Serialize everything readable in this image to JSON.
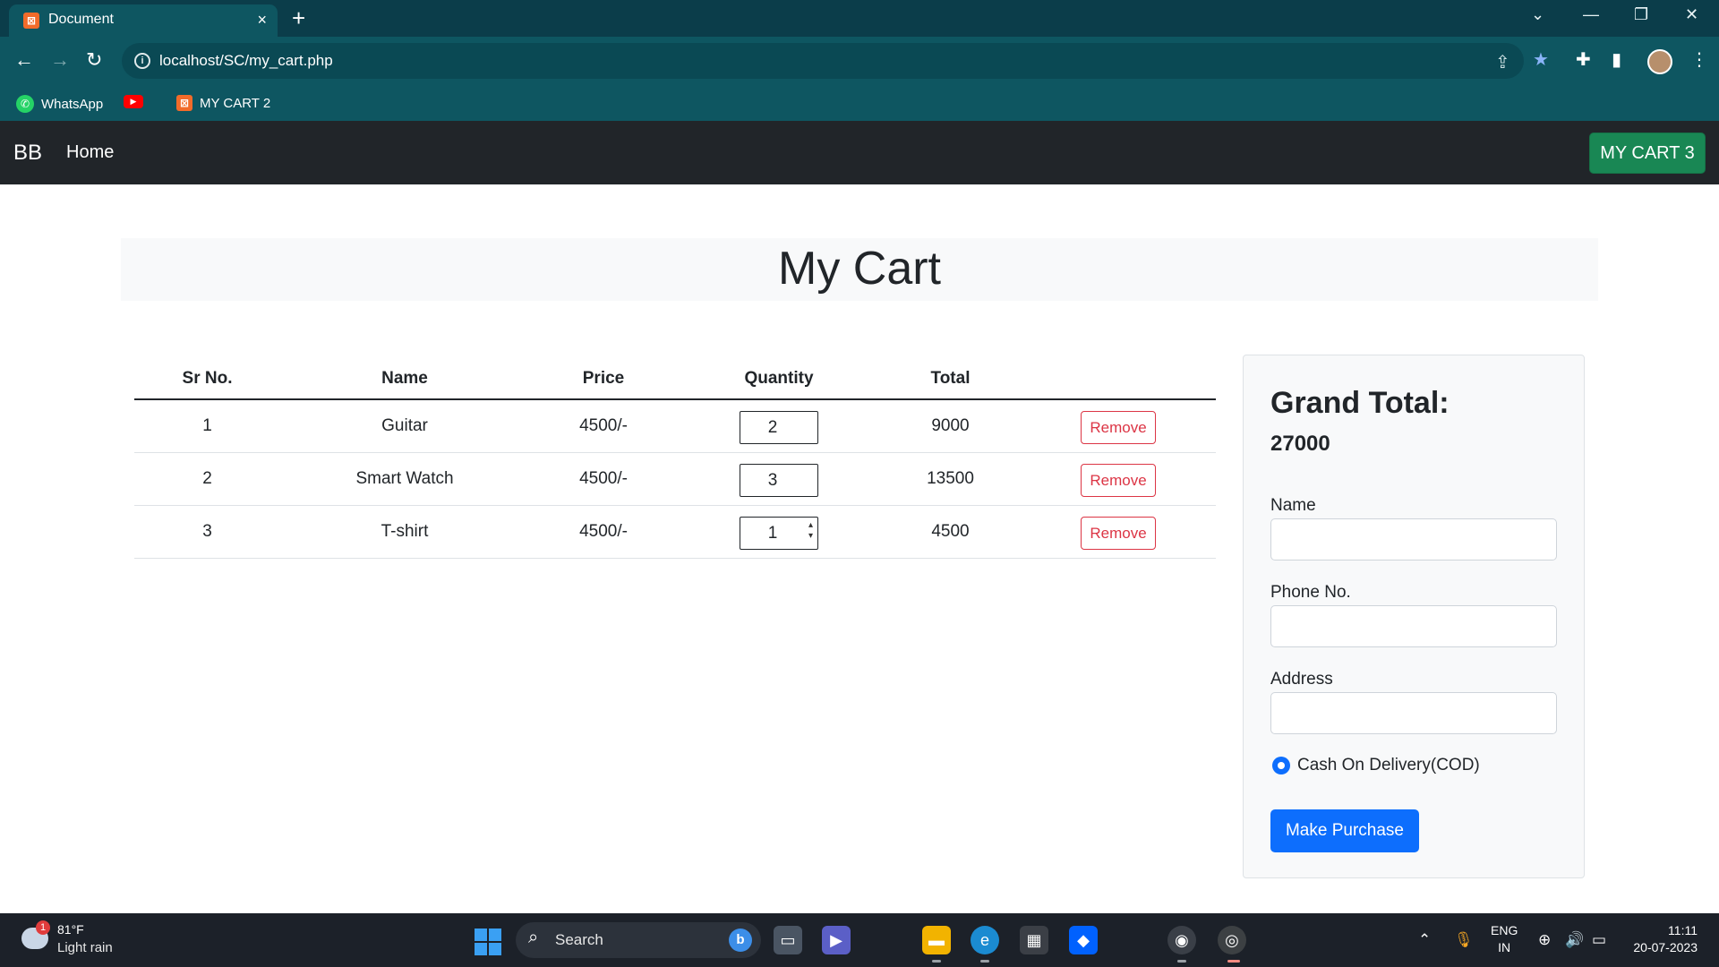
{
  "browser": {
    "tab_title": "Document",
    "tab_close_icon": "×",
    "new_tab_icon": "+",
    "url": "localhost/SC/my_cart.php",
    "window_controls": {
      "dropdown": "⌄",
      "minimize": "—",
      "restore": "❐",
      "close": "✕"
    },
    "bookmarks": [
      {
        "label": "WhatsApp",
        "icon": "whatsapp-icon"
      },
      {
        "label": "",
        "icon": "youtube-icon"
      },
      {
        "label": "MY CART 2",
        "icon": "xampp-icon"
      }
    ]
  },
  "navbar": {
    "brand": "BB",
    "home": "Home",
    "cart_button": "MY CART 3"
  },
  "page": {
    "heading": "My Cart"
  },
  "table": {
    "headers": [
      "Sr No.",
      "Name",
      "Price",
      "Quantity",
      "Total",
      ""
    ],
    "rows": [
      {
        "sr": "1",
        "name": "Guitar",
        "price": "4500/-",
        "qty": "2",
        "total": "9000",
        "action": "Remove"
      },
      {
        "sr": "2",
        "name": "Smart Watch",
        "price": "4500/-",
        "qty": "3",
        "total": "13500",
        "action": "Remove"
      },
      {
        "sr": "3",
        "name": "T-shirt",
        "price": "4500/-",
        "qty": "1",
        "total": "4500",
        "action": "Remove"
      }
    ]
  },
  "checkout": {
    "grand_total_label": "Grand Total:",
    "grand_total_value": "27000",
    "name_label": "Name",
    "phone_label": "Phone No.",
    "address_label": "Address",
    "payment_option": "Cash On Delivery(COD)",
    "purchase_button": "Make Purchase"
  },
  "taskbar": {
    "weather_temp": "81°F",
    "weather_desc": "Light rain",
    "weather_badge": "1",
    "search_label": "Search",
    "lang_line1": "ENG",
    "lang_line2": "IN",
    "time": "11:11",
    "date": "20-07-2023"
  },
  "colors": {
    "browser_frame": "#0e5661",
    "navbar_bg": "#212529",
    "cart_button": "#198754",
    "remove_button": "#dc3545",
    "primary_button": "#0d6efd"
  }
}
